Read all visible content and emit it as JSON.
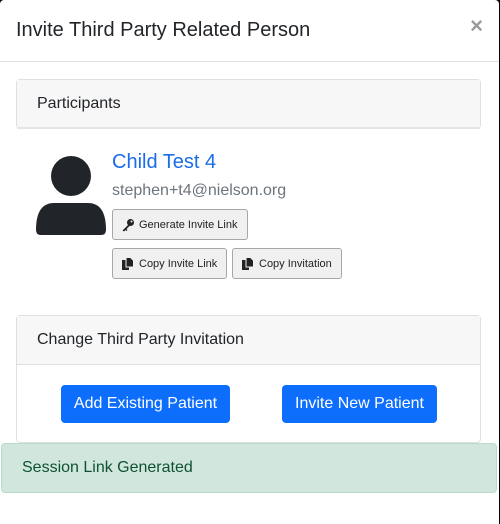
{
  "modal": {
    "title": "Invite Third Party Related Person",
    "close_label": "×"
  },
  "participants": {
    "header": "Participants",
    "person": {
      "name": "Child Test 4",
      "email": "stephen+t4@nielson.org"
    },
    "buttons": {
      "generate_invite_link": "Generate Invite Link",
      "copy_invite_link": "Copy Invite Link",
      "copy_invitation": "Copy Invitation"
    }
  },
  "change_invitation": {
    "header": "Change Third Party Invitation",
    "add_existing_patient": "Add Existing Patient",
    "invite_new_patient": "Invite New Patient"
  },
  "alert": {
    "message": "Session Link Generated"
  },
  "colors": {
    "primary": "#0d6efd",
    "link": "#1a6ce8",
    "success_bg": "#d1e7dd",
    "success_text": "#0f5132"
  },
  "icons": {
    "avatar": "user-silhouette-icon",
    "generate": "key-icon",
    "copy": "copy-icon"
  }
}
